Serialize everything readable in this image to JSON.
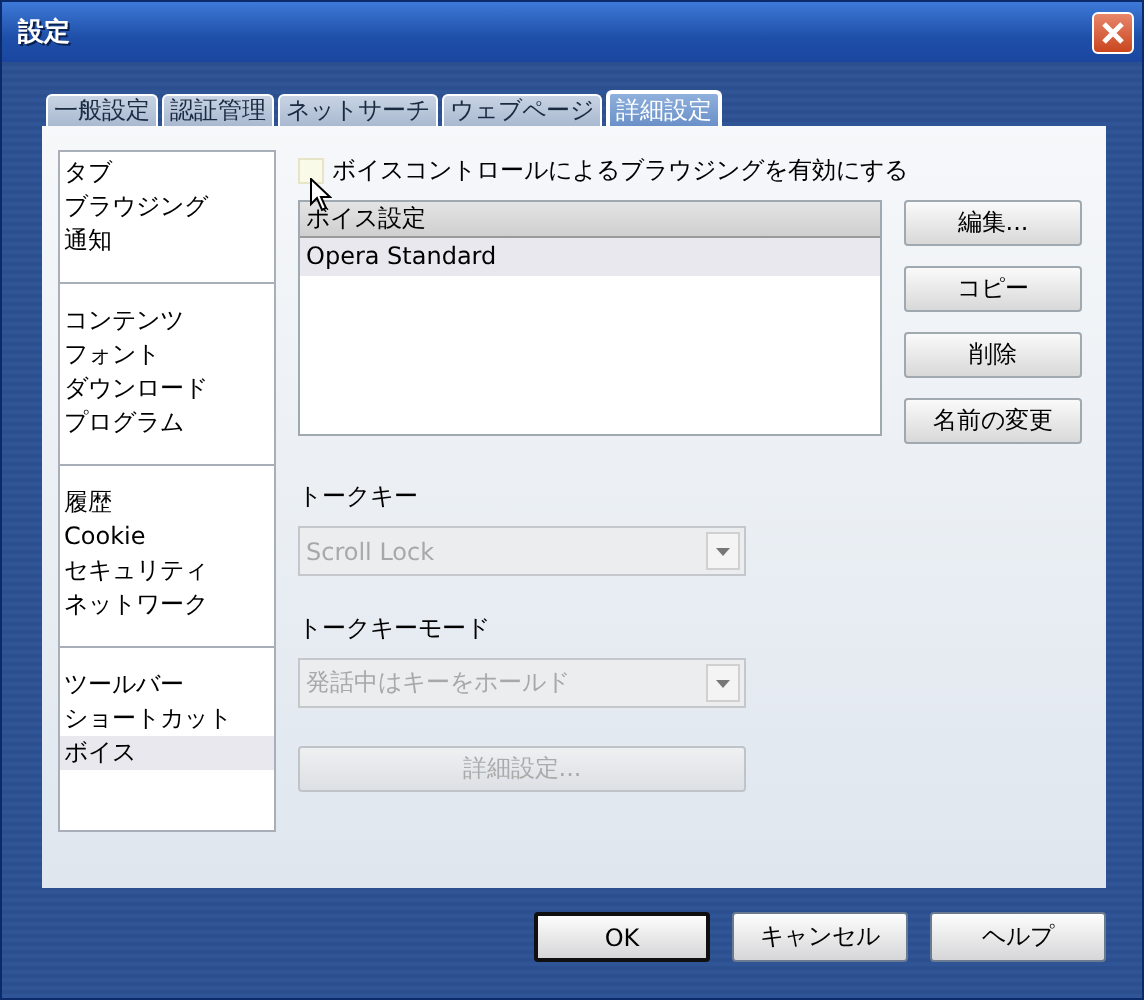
{
  "window": {
    "title": "設定"
  },
  "tabs": [
    {
      "label": "一般設定",
      "selected": false
    },
    {
      "label": "認証管理",
      "selected": false
    },
    {
      "label": "ネットサーチ",
      "selected": false
    },
    {
      "label": "ウェブページ",
      "selected": false
    },
    {
      "label": "詳細設定",
      "selected": true
    }
  ],
  "sidebar": {
    "groups": [
      [
        {
          "label": "タブ",
          "selected": false
        },
        {
          "label": "ブラウジング",
          "selected": false
        },
        {
          "label": "通知",
          "selected": false
        }
      ],
      [
        {
          "label": "コンテンツ",
          "selected": false
        },
        {
          "label": "フォント",
          "selected": false
        },
        {
          "label": "ダウンロード",
          "selected": false
        },
        {
          "label": "プログラム",
          "selected": false
        }
      ],
      [
        {
          "label": "履歴",
          "selected": false
        },
        {
          "label": "Cookie",
          "selected": false
        },
        {
          "label": "セキュリティ",
          "selected": false
        },
        {
          "label": "ネットワーク",
          "selected": false
        }
      ],
      [
        {
          "label": "ツールバー",
          "selected": false
        },
        {
          "label": "ショートカット",
          "selected": false
        },
        {
          "label": "ボイス",
          "selected": true
        }
      ]
    ]
  },
  "voice_control": {
    "label": "ボイスコントロールによるブラウジングを有効にする",
    "checked": false
  },
  "voice_list": {
    "header": "ボイス設定",
    "rows": [
      {
        "label": "Opera Standard",
        "selected": true
      }
    ]
  },
  "list_buttons": [
    "編集...",
    "コピー",
    "削除",
    "名前の変更"
  ],
  "talk_key": {
    "label": "トークキー",
    "value": "Scroll Lock",
    "disabled": true
  },
  "talk_key_mode": {
    "label": "トークキーモード",
    "value": "発話中はキーをホールド",
    "disabled": true
  },
  "advanced_button": {
    "label": "詳細設定...",
    "disabled": true
  },
  "buttons": [
    {
      "label": "OK",
      "default": true
    },
    {
      "label": "キャンセル",
      "default": false
    },
    {
      "label": "ヘルプ",
      "default": false
    }
  ]
}
